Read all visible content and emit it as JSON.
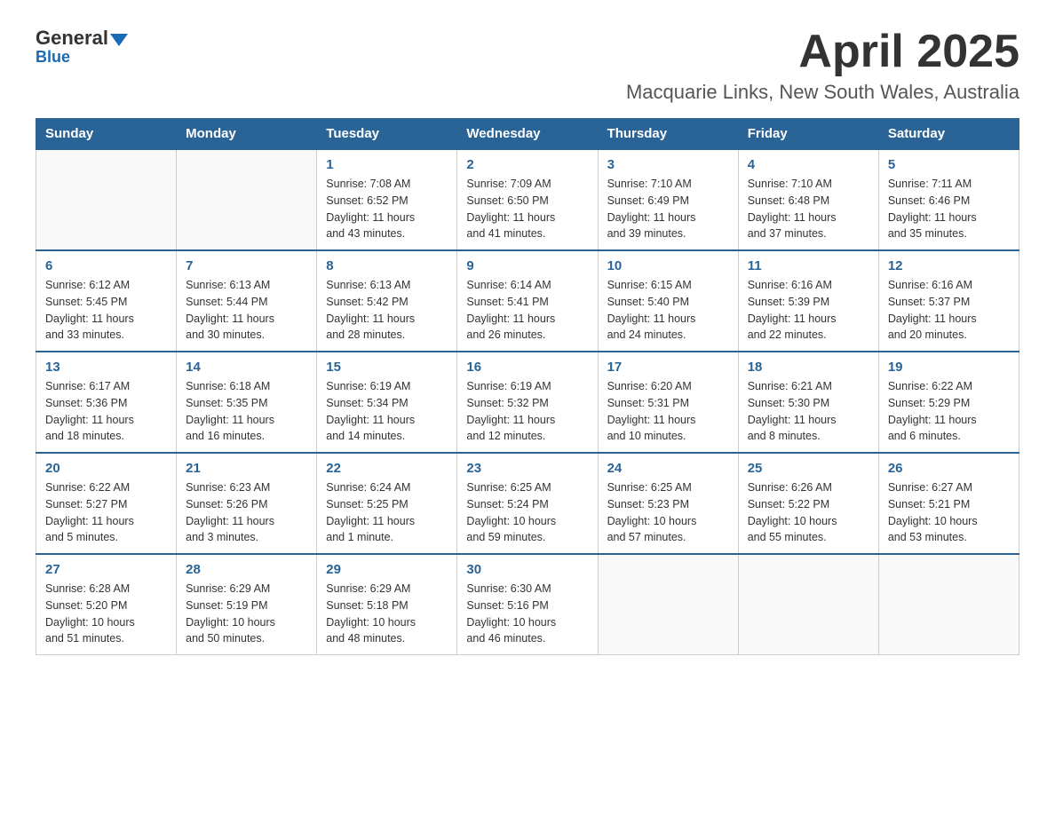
{
  "logo": {
    "general": "General",
    "blue": "Blue",
    "sub": "Blue"
  },
  "header": {
    "month": "April 2025",
    "location": "Macquarie Links, New South Wales, Australia"
  },
  "weekdays": [
    "Sunday",
    "Monday",
    "Tuesday",
    "Wednesday",
    "Thursday",
    "Friday",
    "Saturday"
  ],
  "weeks": [
    [
      {
        "day": "",
        "info": ""
      },
      {
        "day": "",
        "info": ""
      },
      {
        "day": "1",
        "info": "Sunrise: 7:08 AM\nSunset: 6:52 PM\nDaylight: 11 hours\nand 43 minutes."
      },
      {
        "day": "2",
        "info": "Sunrise: 7:09 AM\nSunset: 6:50 PM\nDaylight: 11 hours\nand 41 minutes."
      },
      {
        "day": "3",
        "info": "Sunrise: 7:10 AM\nSunset: 6:49 PM\nDaylight: 11 hours\nand 39 minutes."
      },
      {
        "day": "4",
        "info": "Sunrise: 7:10 AM\nSunset: 6:48 PM\nDaylight: 11 hours\nand 37 minutes."
      },
      {
        "day": "5",
        "info": "Sunrise: 7:11 AM\nSunset: 6:46 PM\nDaylight: 11 hours\nand 35 minutes."
      }
    ],
    [
      {
        "day": "6",
        "info": "Sunrise: 6:12 AM\nSunset: 5:45 PM\nDaylight: 11 hours\nand 33 minutes."
      },
      {
        "day": "7",
        "info": "Sunrise: 6:13 AM\nSunset: 5:44 PM\nDaylight: 11 hours\nand 30 minutes."
      },
      {
        "day": "8",
        "info": "Sunrise: 6:13 AM\nSunset: 5:42 PM\nDaylight: 11 hours\nand 28 minutes."
      },
      {
        "day": "9",
        "info": "Sunrise: 6:14 AM\nSunset: 5:41 PM\nDaylight: 11 hours\nand 26 minutes."
      },
      {
        "day": "10",
        "info": "Sunrise: 6:15 AM\nSunset: 5:40 PM\nDaylight: 11 hours\nand 24 minutes."
      },
      {
        "day": "11",
        "info": "Sunrise: 6:16 AM\nSunset: 5:39 PM\nDaylight: 11 hours\nand 22 minutes."
      },
      {
        "day": "12",
        "info": "Sunrise: 6:16 AM\nSunset: 5:37 PM\nDaylight: 11 hours\nand 20 minutes."
      }
    ],
    [
      {
        "day": "13",
        "info": "Sunrise: 6:17 AM\nSunset: 5:36 PM\nDaylight: 11 hours\nand 18 minutes."
      },
      {
        "day": "14",
        "info": "Sunrise: 6:18 AM\nSunset: 5:35 PM\nDaylight: 11 hours\nand 16 minutes."
      },
      {
        "day": "15",
        "info": "Sunrise: 6:19 AM\nSunset: 5:34 PM\nDaylight: 11 hours\nand 14 minutes."
      },
      {
        "day": "16",
        "info": "Sunrise: 6:19 AM\nSunset: 5:32 PM\nDaylight: 11 hours\nand 12 minutes."
      },
      {
        "day": "17",
        "info": "Sunrise: 6:20 AM\nSunset: 5:31 PM\nDaylight: 11 hours\nand 10 minutes."
      },
      {
        "day": "18",
        "info": "Sunrise: 6:21 AM\nSunset: 5:30 PM\nDaylight: 11 hours\nand 8 minutes."
      },
      {
        "day": "19",
        "info": "Sunrise: 6:22 AM\nSunset: 5:29 PM\nDaylight: 11 hours\nand 6 minutes."
      }
    ],
    [
      {
        "day": "20",
        "info": "Sunrise: 6:22 AM\nSunset: 5:27 PM\nDaylight: 11 hours\nand 5 minutes."
      },
      {
        "day": "21",
        "info": "Sunrise: 6:23 AM\nSunset: 5:26 PM\nDaylight: 11 hours\nand 3 minutes."
      },
      {
        "day": "22",
        "info": "Sunrise: 6:24 AM\nSunset: 5:25 PM\nDaylight: 11 hours\nand 1 minute."
      },
      {
        "day": "23",
        "info": "Sunrise: 6:25 AM\nSunset: 5:24 PM\nDaylight: 10 hours\nand 59 minutes."
      },
      {
        "day": "24",
        "info": "Sunrise: 6:25 AM\nSunset: 5:23 PM\nDaylight: 10 hours\nand 57 minutes."
      },
      {
        "day": "25",
        "info": "Sunrise: 6:26 AM\nSunset: 5:22 PM\nDaylight: 10 hours\nand 55 minutes."
      },
      {
        "day": "26",
        "info": "Sunrise: 6:27 AM\nSunset: 5:21 PM\nDaylight: 10 hours\nand 53 minutes."
      }
    ],
    [
      {
        "day": "27",
        "info": "Sunrise: 6:28 AM\nSunset: 5:20 PM\nDaylight: 10 hours\nand 51 minutes."
      },
      {
        "day": "28",
        "info": "Sunrise: 6:29 AM\nSunset: 5:19 PM\nDaylight: 10 hours\nand 50 minutes."
      },
      {
        "day": "29",
        "info": "Sunrise: 6:29 AM\nSunset: 5:18 PM\nDaylight: 10 hours\nand 48 minutes."
      },
      {
        "day": "30",
        "info": "Sunrise: 6:30 AM\nSunset: 5:16 PM\nDaylight: 10 hours\nand 46 minutes."
      },
      {
        "day": "",
        "info": ""
      },
      {
        "day": "",
        "info": ""
      },
      {
        "day": "",
        "info": ""
      }
    ]
  ]
}
